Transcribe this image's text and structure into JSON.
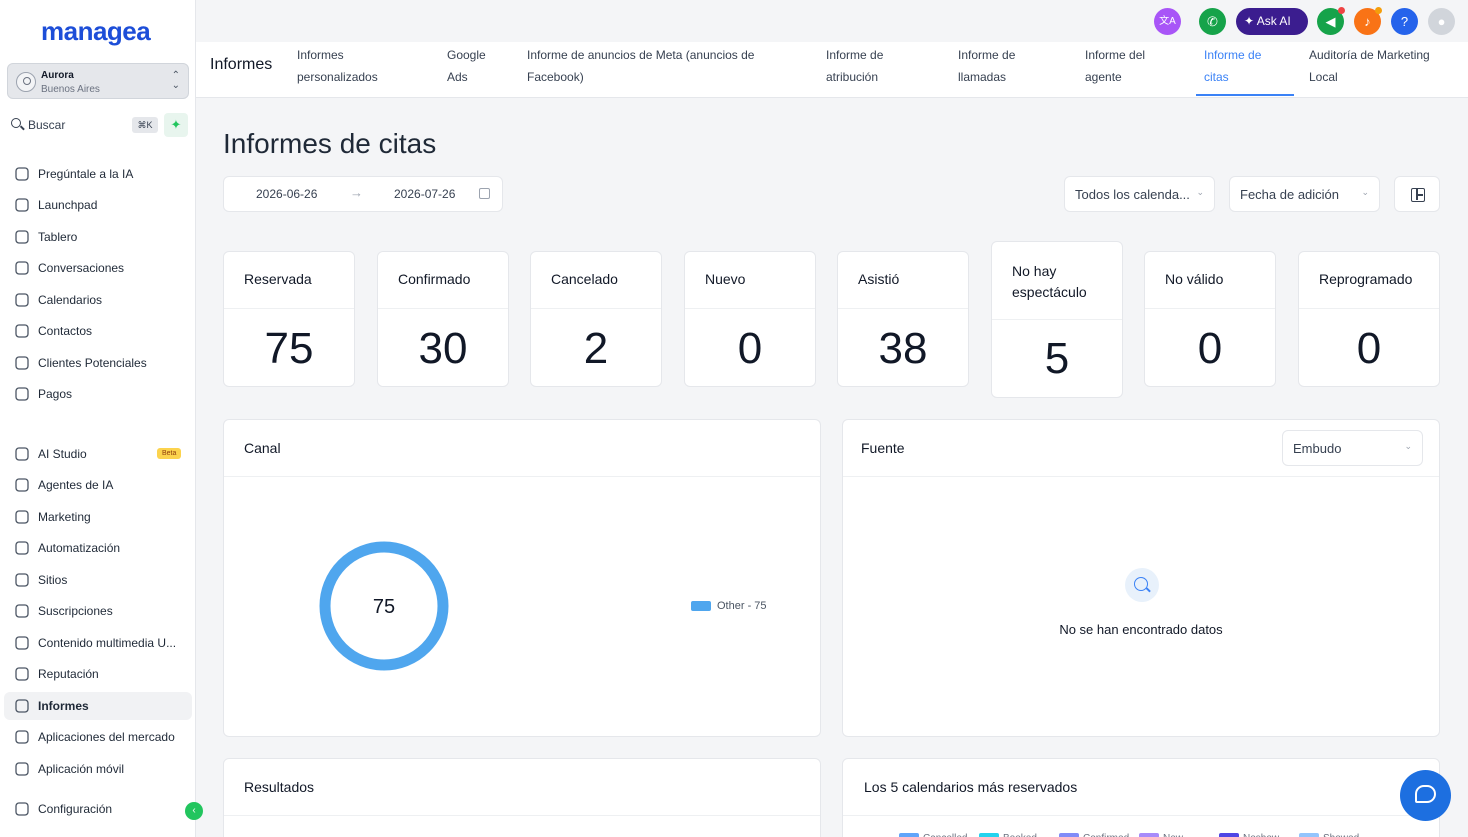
{
  "brand": {
    "logo": "managea"
  },
  "account": {
    "name": "Aurora",
    "location": "Buenos Aires"
  },
  "search": {
    "label": "Buscar",
    "shortcut": "⌘K"
  },
  "sidebar": {
    "items": [
      {
        "label": "Pregúntale a la IA",
        "icon": "sparkle-icon"
      },
      {
        "label": "Launchpad",
        "icon": "rocket-icon"
      },
      {
        "label": "Tablero",
        "icon": "dashboard-icon"
      },
      {
        "label": "Conversaciones",
        "icon": "chat-icon"
      },
      {
        "label": "Calendarios",
        "icon": "calendar-icon"
      },
      {
        "label": "Contactos",
        "icon": "contacts-icon"
      },
      {
        "label": "Clientes Potenciales",
        "icon": "leads-icon"
      },
      {
        "label": "Pagos",
        "icon": "payments-icon"
      },
      {
        "label": "AI Studio",
        "icon": "ai-studio-icon",
        "badge": "Beta"
      },
      {
        "label": "Agentes de IA",
        "icon": "agents-icon"
      },
      {
        "label": "Marketing",
        "icon": "send-icon"
      },
      {
        "label": "Automatización",
        "icon": "automation-icon"
      },
      {
        "label": "Sitios",
        "icon": "sites-icon"
      },
      {
        "label": "Suscripciones",
        "icon": "memberships-icon"
      },
      {
        "label": "Contenido multimedia U...",
        "icon": "media-icon"
      },
      {
        "label": "Reputación",
        "icon": "star-icon"
      },
      {
        "label": "Informes",
        "icon": "trend-icon",
        "active": true
      },
      {
        "label": "Aplicaciones del mercado",
        "icon": "apps-icon"
      },
      {
        "label": "Aplicación móvil",
        "icon": "mobile-icon"
      },
      {
        "label": "Configuración",
        "icon": "gear-icon"
      }
    ]
  },
  "topbar": {
    "ask_ai": "Ask AI",
    "help": "?"
  },
  "tabs": {
    "title": "Informes",
    "items": [
      {
        "line1": "Informes",
        "line2": "personalizados"
      },
      {
        "line1": "Google",
        "line2": "Ads"
      },
      {
        "line1": "Informe de anuncios de Meta (anuncios de",
        "line2": "Facebook)"
      },
      {
        "line1": "Informe de",
        "line2": "atribución"
      },
      {
        "line1": "Informe de",
        "line2": "llamadas"
      },
      {
        "line1": "Informe del",
        "line2": "agente"
      },
      {
        "line1": "Informe de",
        "line2": "citas",
        "active": true
      },
      {
        "line1": "Auditoría de Marketing",
        "line2": "Local"
      }
    ]
  },
  "page": {
    "title": "Informes de citas",
    "date_start": "2026-06-26",
    "date_end": "2026-07-26",
    "calendar_filter": "Todos los calenda...",
    "date_filter": "Fecha de adición"
  },
  "stats": [
    {
      "label": "Reservada",
      "value": "75"
    },
    {
      "label": "Confirmado",
      "value": "30"
    },
    {
      "label": "Cancelado",
      "value": "2"
    },
    {
      "label": "Nuevo",
      "value": "0"
    },
    {
      "label": "Asistió",
      "value": "38"
    },
    {
      "label": "No hay espectáculo",
      "value": "5"
    },
    {
      "label": "No válido",
      "value": "0"
    },
    {
      "label": "Reprogramado",
      "value": "0"
    }
  ],
  "canal": {
    "title": "Canal",
    "center_value": "75",
    "legend": "Other - 75",
    "color": "#4fa6ee"
  },
  "fuente": {
    "title": "Fuente",
    "filter": "Embudo",
    "empty": "No se han encontrado datos"
  },
  "resultados": {
    "title": "Resultados"
  },
  "top_calendars": {
    "title": "Los 5 calendarios más reservados",
    "legend": [
      "Cancelled",
      "Booked",
      "Confirmed",
      "New",
      "Noshow",
      "Showed"
    ]
  },
  "colors": {
    "accent": "#3b82f6",
    "brand": "#1d4ed8",
    "success": "#22c55e"
  }
}
